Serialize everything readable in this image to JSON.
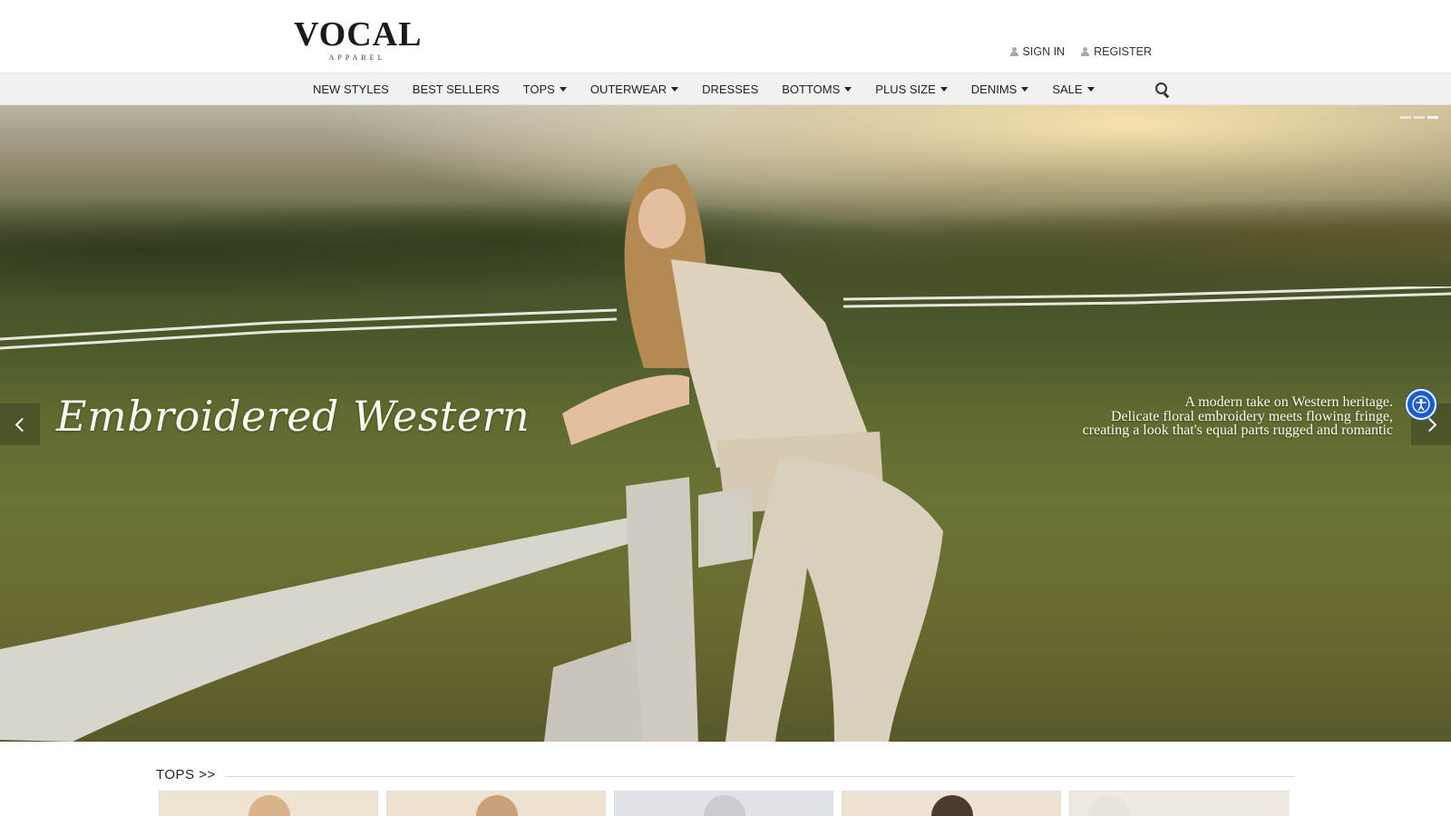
{
  "brand": {
    "name": "VOCAL",
    "tagline": "APPAREL"
  },
  "account": {
    "sign_in": "SIGN IN",
    "register": "REGISTER"
  },
  "nav": {
    "items": [
      {
        "label": "NEW STYLES",
        "dropdown": false
      },
      {
        "label": "BEST SELLERS",
        "dropdown": false
      },
      {
        "label": "TOPS",
        "dropdown": true
      },
      {
        "label": "OUTERWEAR",
        "dropdown": true
      },
      {
        "label": "DRESSES",
        "dropdown": false
      },
      {
        "label": "BOTTOMS",
        "dropdown": true
      },
      {
        "label": "PLUS SIZE",
        "dropdown": true
      },
      {
        "label": "DENIMS",
        "dropdown": true
      },
      {
        "label": "SALE",
        "dropdown": true
      }
    ],
    "search_icon": "search-icon"
  },
  "hero": {
    "title": "Embroidered Western",
    "description_lines": [
      "A modern take on Western heritage.",
      "Delicate floral embroidery meets flowing fringe,",
      "creating a look that's equal parts rugged and romantic"
    ],
    "slide_count": 3,
    "active_slide": 3
  },
  "section": {
    "title": "TOPS >>",
    "product_card_count": 5,
    "card_backgrounds": [
      "#efe3d2",
      "#efe1cf",
      "#dfe3e8",
      "#f0e2d2",
      "#eeeae0"
    ]
  },
  "colors": {
    "nav_background": "#f1f1f1",
    "accessibility_button": "#1a5cd8",
    "hero_text": "#fbf8f0"
  },
  "accessibility": {
    "icon": "accessibility-icon"
  }
}
